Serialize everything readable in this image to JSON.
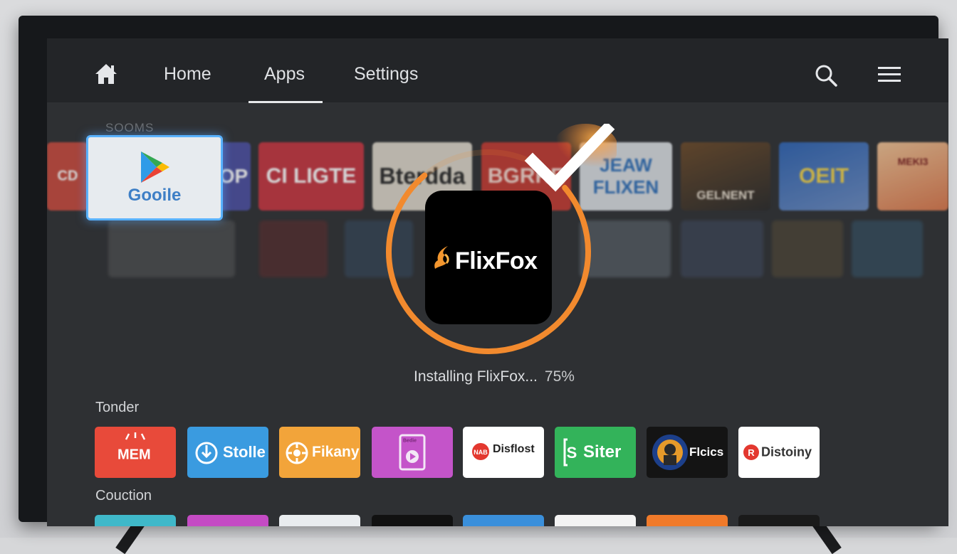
{
  "nav": {
    "home_label": "Home",
    "apps_label": "Apps",
    "settings_label": "Settings"
  },
  "icons": {
    "home": "home-icon",
    "search": "search-icon",
    "menu": "hamburger-menu-icon",
    "check": "check-icon"
  },
  "carousel": {
    "section_label": "SOOMS",
    "google_tile_label": "Gooile",
    "tiles": [
      {
        "label": "CD",
        "color": "#c64a3d"
      },
      {
        "label": "OP",
        "color": "#4b4fa0"
      },
      {
        "label": "CI LIGTE",
        "color": "#c43540"
      },
      {
        "label": "Bterdda",
        "color": "#dcd6c9"
      },
      {
        "label": "BGRRE",
        "color": "#c23a32"
      },
      {
        "label": "JEAW FLIXEN",
        "color": "#d9dde1"
      },
      {
        "label": "GELNENT",
        "color": "#4a3a2e"
      },
      {
        "label": "OEIT",
        "color": "#3f6aa8"
      },
      {
        "label": "MEKI3",
        "color": "#e6ad7a"
      }
    ]
  },
  "installer": {
    "app_name": "FlixFox",
    "status_text": "Installing FlixFox...",
    "progress_text": "75%",
    "progress_fraction": 0.75,
    "accent_color": "#f28a2e"
  },
  "rows": [
    {
      "title": "Tonder",
      "apps": [
        {
          "label": "MEM",
          "bg": "#e84a3a",
          "fg": "#ffffff"
        },
        {
          "label": "Stolle",
          "bg": "#3a9be0",
          "fg": "#ffffff"
        },
        {
          "label": "Fikany",
          "bg": "#f2a43a",
          "fg": "#ffffff"
        },
        {
          "label": "Bedie",
          "bg": "#c454c9",
          "fg": "#ffffff"
        },
        {
          "label": "Disflost",
          "bg": "#ffffff",
          "fg": "#222222"
        },
        {
          "label": "Siter",
          "bg": "#33b35a",
          "fg": "#ffffff"
        },
        {
          "label": "Flcics",
          "bg": "#141414",
          "fg": "#ffffff"
        },
        {
          "label": "Distoiny",
          "bg": "#ffffff",
          "fg": "#333333"
        }
      ]
    },
    {
      "title": "Couction",
      "peek_colors": [
        "#3fb8c9",
        "#c44bc4",
        "#e9ecef",
        "#111111",
        "#3a8fdb",
        "#f3f3f3",
        "#f07a2a",
        "#1a1a1a"
      ]
    }
  ]
}
